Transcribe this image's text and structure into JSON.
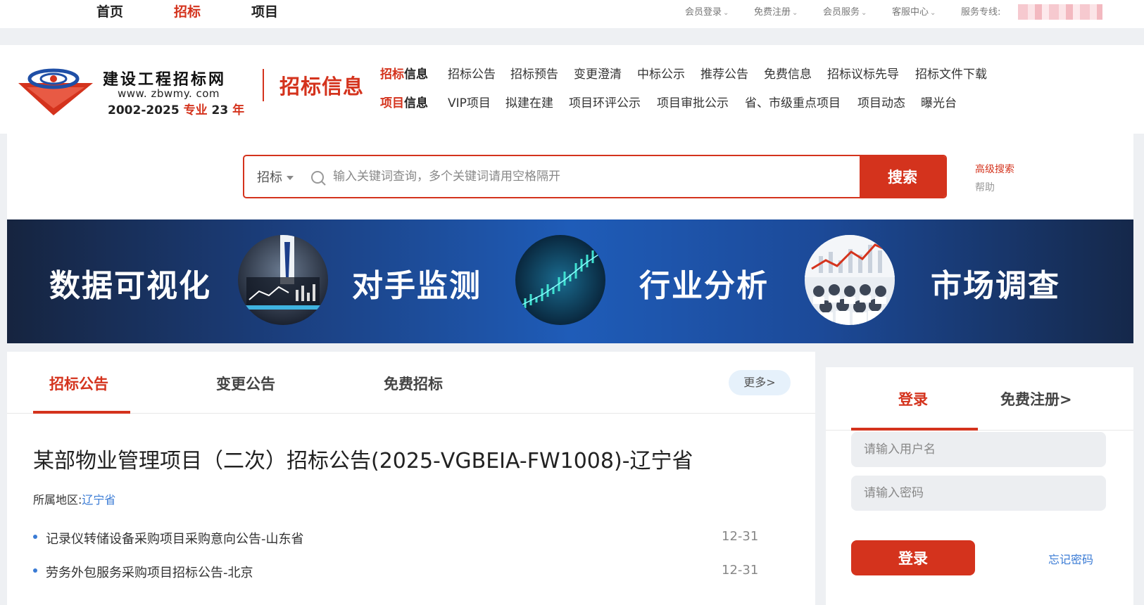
{
  "topbar": {
    "nav": [
      "首页",
      "招标",
      "项目"
    ],
    "active_nav": "招标",
    "links": [
      "会员登录",
      "免费注册",
      "会员服务",
      "客服中心"
    ],
    "service_label": "服务专线:"
  },
  "header": {
    "logo_title": "建设工程招标网",
    "logo_url": "www. zbwmy. com",
    "logo_years_prefix": "2002-2025",
    "logo_years_red": "专业",
    "logo_years_suffix": "23",
    "logo_years_nian": "年",
    "section_title": "招标信息",
    "menu_row1": {
      "head_red": "招标",
      "head_rest": "信息",
      "items": [
        "招标公告",
        "招标预告",
        "变更澄清",
        "中标公示",
        "推荐公告",
        "免费信息",
        "招标议标先导",
        "招标文件下载"
      ]
    },
    "menu_row2": {
      "head_red": "项目",
      "head_rest": "信息",
      "items": [
        "VIP项目",
        "拟建在建",
        "项目环评公示",
        "项目审批公示",
        "省、市级重点项目",
        "项目动态",
        "曝光台"
      ]
    }
  },
  "search": {
    "type": "招标",
    "placeholder": "输入关键词查询，多个关键词请用空格隔开",
    "button": "搜索",
    "advanced": "高级搜索",
    "help": "帮助"
  },
  "banner": {
    "items": [
      "数据可视化",
      "对手监测",
      "行业分析",
      "市场调查"
    ]
  },
  "main": {
    "tabs": [
      "招标公告",
      "变更公告",
      "免费招标"
    ],
    "more": "更多>",
    "article_title": "某部物业管理项目（二次）招标公告(2025-VGBEIA-FW1008)-辽宁省",
    "region_label": "所属地区:",
    "region_value": "辽宁省",
    "list": [
      {
        "text": "记录仪转储设备采购项目采购意向公告-山东省",
        "date": "12-31"
      },
      {
        "text": "劳务外包服务采购项目招标公告-北京",
        "date": "12-31"
      }
    ]
  },
  "login": {
    "tab_login": "登录",
    "tab_register": "免费注册>",
    "username_placeholder": "请输入用户名",
    "password_placeholder": "请输入密码",
    "button": "登录",
    "forgot": "忘记密码"
  },
  "colors": {
    "brand_red": "#d4331d",
    "link_blue": "#3a7bd5"
  }
}
